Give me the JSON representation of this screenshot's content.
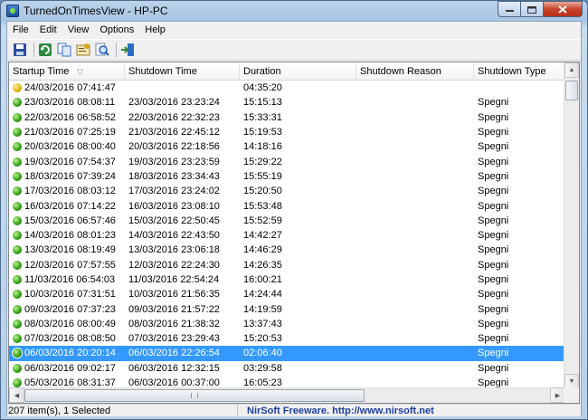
{
  "window": {
    "title": "TurnedOnTimesView  -  HP-PC"
  },
  "menu": [
    "File",
    "Edit",
    "View",
    "Options",
    "Help"
  ],
  "toolbar_icons": [
    "save-icon",
    "refresh-icon",
    "copy-icon",
    "properties-icon",
    "find-icon",
    "exit-icon"
  ],
  "columns": [
    "Startup Time",
    "Shutdown Time",
    "Duration",
    "Shutdown Reason",
    "Shutdown Type"
  ],
  "rows": [
    {
      "startup": "24/03/2016 07:41:47",
      "shutdown": "",
      "duration": "04:35:20",
      "reason": "",
      "type": "",
      "status": "yellow",
      "selected": false
    },
    {
      "startup": "23/03/2016 08:08:11",
      "shutdown": "23/03/2016 23:23:24",
      "duration": "15:15:13",
      "reason": "",
      "type": "Spegni",
      "status": "green",
      "selected": false
    },
    {
      "startup": "22/03/2016 06:58:52",
      "shutdown": "22/03/2016 22:32:23",
      "duration": "15:33:31",
      "reason": "",
      "type": "Spegni",
      "status": "green",
      "selected": false
    },
    {
      "startup": "21/03/2016 07:25:19",
      "shutdown": "21/03/2016 22:45:12",
      "duration": "15:19:53",
      "reason": "",
      "type": "Spegni",
      "status": "green",
      "selected": false
    },
    {
      "startup": "20/03/2016 08:00:40",
      "shutdown": "20/03/2016 22:18:56",
      "duration": "14:18:16",
      "reason": "",
      "type": "Spegni",
      "status": "green",
      "selected": false
    },
    {
      "startup": "19/03/2016 07:54:37",
      "shutdown": "19/03/2016 23:23:59",
      "duration": "15:29:22",
      "reason": "",
      "type": "Spegni",
      "status": "green",
      "selected": false
    },
    {
      "startup": "18/03/2016 07:39:24",
      "shutdown": "18/03/2016 23:34:43",
      "duration": "15:55:19",
      "reason": "",
      "type": "Spegni",
      "status": "green",
      "selected": false
    },
    {
      "startup": "17/03/2016 08:03:12",
      "shutdown": "17/03/2016 23:24:02",
      "duration": "15:20:50",
      "reason": "",
      "type": "Spegni",
      "status": "green",
      "selected": false
    },
    {
      "startup": "16/03/2016 07:14:22",
      "shutdown": "16/03/2016 23:08:10",
      "duration": "15:53:48",
      "reason": "",
      "type": "Spegni",
      "status": "green",
      "selected": false
    },
    {
      "startup": "15/03/2016 06:57:46",
      "shutdown": "15/03/2016 22:50:45",
      "duration": "15:52:59",
      "reason": "",
      "type": "Spegni",
      "status": "green",
      "selected": false
    },
    {
      "startup": "14/03/2016 08:01:23",
      "shutdown": "14/03/2016 22:43:50",
      "duration": "14:42:27",
      "reason": "",
      "type": "Spegni",
      "status": "green",
      "selected": false
    },
    {
      "startup": "13/03/2016 08:19:49",
      "shutdown": "13/03/2016 23:06:18",
      "duration": "14:46:29",
      "reason": "",
      "type": "Spegni",
      "status": "green",
      "selected": false
    },
    {
      "startup": "12/03/2016 07:57:55",
      "shutdown": "12/03/2016 22:24:30",
      "duration": "14:26:35",
      "reason": "",
      "type": "Spegni",
      "status": "green",
      "selected": false
    },
    {
      "startup": "11/03/2016 06:54:03",
      "shutdown": "11/03/2016 22:54:24",
      "duration": "16:00:21",
      "reason": "",
      "type": "Spegni",
      "status": "green",
      "selected": false
    },
    {
      "startup": "10/03/2016 07:31:51",
      "shutdown": "10/03/2016 21:56:35",
      "duration": "14:24:44",
      "reason": "",
      "type": "Spegni",
      "status": "green",
      "selected": false
    },
    {
      "startup": "09/03/2016 07:37:23",
      "shutdown": "09/03/2016 21:57:22",
      "duration": "14:19:59",
      "reason": "",
      "type": "Spegni",
      "status": "green",
      "selected": false
    },
    {
      "startup": "08/03/2016 08:00:49",
      "shutdown": "08/03/2016 21:38:32",
      "duration": "13:37:43",
      "reason": "",
      "type": "Spegni",
      "status": "green",
      "selected": false
    },
    {
      "startup": "07/03/2016 08:08:50",
      "shutdown": "07/03/2016 23:29:43",
      "duration": "15:20:53",
      "reason": "",
      "type": "Spegni",
      "status": "green",
      "selected": false
    },
    {
      "startup": "06/03/2016 20:20:14",
      "shutdown": "06/03/2016 22:26:54",
      "duration": "02:06:40",
      "reason": "",
      "type": "Spegni",
      "status": "green",
      "selected": true
    },
    {
      "startup": "06/03/2016 09:02:17",
      "shutdown": "06/03/2016 12:32:15",
      "duration": "03:29:58",
      "reason": "",
      "type": "Spegni",
      "status": "green",
      "selected": false
    },
    {
      "startup": "05/03/2016 08:31:37",
      "shutdown": "06/03/2016 00:37:00",
      "duration": "16:05:23",
      "reason": "",
      "type": "Spegni",
      "status": "green",
      "selected": false
    }
  ],
  "status": {
    "count": "207 item(s), 1 Selected",
    "credit": "NirSoft Freeware.  http://www.nirsoft.net"
  },
  "colors": {
    "selection": "#3399ff",
    "credit": "#1f3f9e"
  }
}
